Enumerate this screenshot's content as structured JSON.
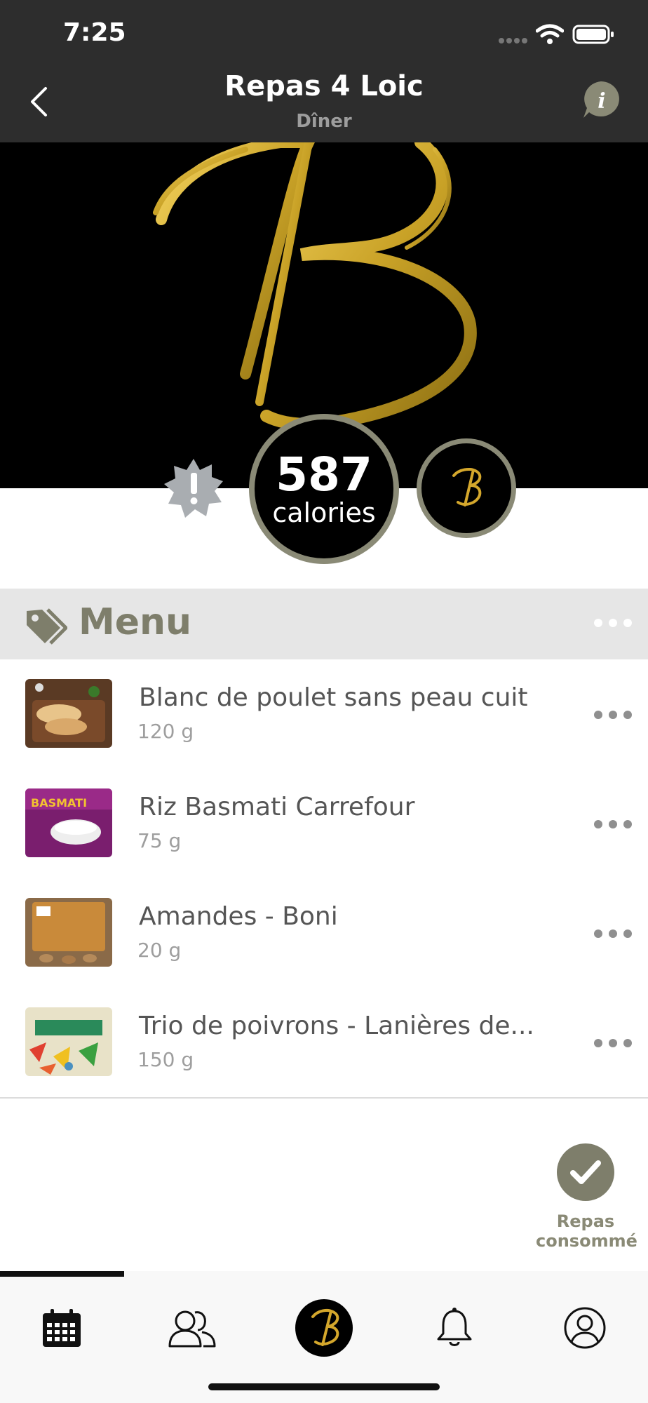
{
  "status_bar": {
    "time": "7:25"
  },
  "nav": {
    "title": "Repas 4 Loic",
    "subtitle": "Dîner"
  },
  "summary": {
    "calories_value": "587",
    "calories_label": "calories"
  },
  "menu": {
    "title": "Menu",
    "items": [
      {
        "name": "Blanc de poulet sans peau cuit",
        "quantity": "120 g"
      },
      {
        "name": "Riz Basmati Carrefour",
        "quantity": "75 g"
      },
      {
        "name": "Amandes - Boni",
        "quantity": "20 g"
      },
      {
        "name": "Trio de poivrons - Lanières de...",
        "quantity": "150 g"
      }
    ]
  },
  "actions": {
    "consumed_label_line1": "Repas",
    "consumed_label_line2": "consommé"
  },
  "tabs": [
    "calendar",
    "community",
    "brand-home",
    "notifications",
    "profile"
  ],
  "colors": {
    "accent": "#7e7e6b",
    "gold": "#c9a227",
    "bar": "#2d2d2d"
  }
}
